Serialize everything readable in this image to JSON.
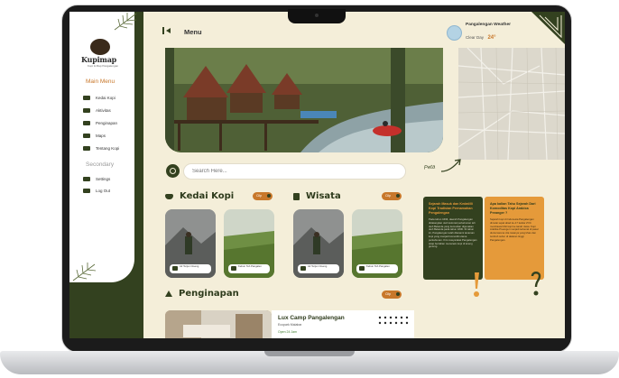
{
  "app": {
    "name": "Kupimap",
    "tagline": "Kopi & Map Pangalengan"
  },
  "header": {
    "title": "Menu"
  },
  "weather": {
    "location": "Pangalengan Weather",
    "condition": "Clear Day",
    "temperature": "24°"
  },
  "sidebar": {
    "main_title": "Main Menu",
    "main_items": [
      {
        "label": "Kedai Kopi",
        "icon": "coffee-cup-icon"
      },
      {
        "label": "Aktivitas",
        "icon": "hiking-icon"
      },
      {
        "label": "Penginapan",
        "icon": "bed-icon"
      },
      {
        "label": "Maps",
        "icon": "map-icon"
      },
      {
        "label": "Tentang Kopi",
        "icon": "coffee-bean-icon"
      }
    ],
    "secondary_title": "Secondary",
    "secondary_items": [
      {
        "label": "Settings",
        "icon": "gear-icon"
      },
      {
        "label": "Log Out",
        "icon": "logout-icon"
      }
    ]
  },
  "search": {
    "placeholder": "Search Here..."
  },
  "map": {
    "label": "Peta"
  },
  "sections": {
    "kedai_kopi": {
      "title": "Kedai Kopi",
      "pill": "Cilp"
    },
    "wisata": {
      "title": "Wisata",
      "pill": "Cilp"
    },
    "penginapan": {
      "title": "Penginapan",
      "pill": "Cilp"
    }
  },
  "cards": {
    "kedai_kopi": [
      {
        "caption": "Air Terjun Ciseng"
      },
      {
        "caption": "Kebun Teh Pangalen"
      }
    ],
    "wisata": [
      {
        "caption": "Air Terjun Ciseng"
      },
      {
        "caption": "Kebun Teh Pangalen"
      }
    ]
  },
  "info_cards": [
    {
      "title": "Sejarah Masuk dan Kedatilli Kopi Tradisian Pernamahan Pengalengan",
      "body": "Pada tahun 1696, daerah Pangalengan didatangkan oleh kolonial perkebunan teh oleh Belanda yang kemudian digunakan oleh Belanda pada tahun 1830. Di tahun ini, Pangalengan telah ditanami tanaman kopi yang menjadi komoditi utama perkebunan. Kini masyarakat Pangalengan tetap bertahan menanam kopi di lereng gunung."
    },
    {
      "title": "Apa kalian Tahu Sejarah Dari Komoditas Kopi Arabica Preanger ?",
      "body": "Sejarah kopi di Indonesia Pangalengan dimulai sejak abad ke-17 ketika VOC membawa bibit kopi ke tanah Jawa. Kopi Arabika Preanger menjadi terkenal di pasar dunia karena cita rasanya yang khas dan tumbuh subur di dataran tinggi Pangalengan."
    }
  ],
  "penginapan": {
    "name": "Lux Camp Pangalengan",
    "location": "Ecopark Malabar",
    "status": "Open 24 Jam"
  }
}
